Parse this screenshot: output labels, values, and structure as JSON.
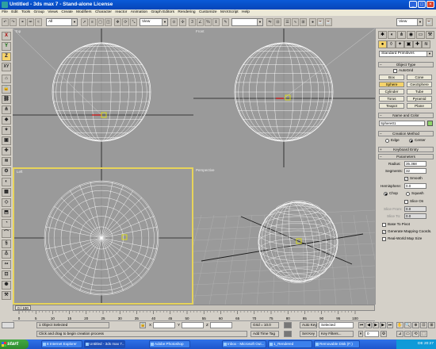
{
  "window": {
    "title": "Untitled - 3ds max 7 - Stand-alone License",
    "controls": {
      "minimize": "_",
      "maximize": "□",
      "close": "×"
    }
  },
  "menu": [
    "File",
    "Edit",
    "Tools",
    "Group",
    "Views",
    "Create",
    "Modifiers",
    "Character",
    "reactor",
    "Animation",
    "Graph Editors",
    "Rendering",
    "Customize",
    "MAXScript",
    "Help"
  ],
  "toolbar": {
    "selection_filter": "All",
    "ref_coord": "View",
    "named_selection": "",
    "render_view": "View"
  },
  "left_toolbar": {
    "x_label": "X",
    "y_label": "Y",
    "z_label": "Z",
    "xy_label": "XY"
  },
  "viewports": {
    "top": "Top",
    "front": "Front",
    "left": "Left",
    "perspective": "Perspective"
  },
  "command_panel": {
    "category": "Standard Primitives",
    "object_type": {
      "title": "Object Type",
      "autogrid": "AutoGrid",
      "buttons": [
        "Box",
        "Cone",
        "Sphere",
        "GeoSphere",
        "Cylinder",
        "Tube",
        "Torus",
        "Pyramid",
        "Teapot",
        "Plane"
      ],
      "selected": "Sphere"
    },
    "name_color": {
      "title": "Name and Color",
      "name": "Sphere01"
    },
    "creation": {
      "title": "Creation Method",
      "edge": "Edge",
      "center": "Center"
    },
    "keyboard": {
      "title": "Keyboard Entry"
    },
    "parameters": {
      "title": "Parameters",
      "radius_label": "Radius:",
      "radius": "35.368",
      "segments_label": "Segments:",
      "segments": "32",
      "smooth": "Smooth",
      "hemisphere_label": "Hemisphere:",
      "hemisphere": "0.0",
      "chop": "Chop",
      "squash": "Squash",
      "slice_on": "Slice On",
      "slice_from_label": "Slice From:",
      "slice_from": "0.0",
      "slice_to_label": "Slice To:",
      "slice_to": "0.0",
      "base_to_pivot": "Base To Pivot",
      "gen_mapping": "Generate Mapping Coords.",
      "real_world": "Real-World Map Size"
    }
  },
  "timeline": {
    "frame_label": "0 / 100",
    "ticks": [
      "0",
      "5",
      "10",
      "15",
      "20",
      "25",
      "30",
      "35",
      "40",
      "45",
      "50",
      "55",
      "60",
      "65",
      "70",
      "75",
      "80",
      "85",
      "90",
      "95",
      "100"
    ]
  },
  "status": {
    "selected": "1 Object Selected",
    "prompt": "Click and drag to begin creation process",
    "x_label": "X",
    "y_label": "Y",
    "z_label": "Z",
    "grid": "Grid = 10.0",
    "add_time_tag": "Add Time Tag",
    "auto_key": "Auto Key",
    "set_key": "Set Key",
    "key_mode": "Selected",
    "key_filters": "Key Filters...",
    "frame_value": "0"
  },
  "taskbar": {
    "start": "start",
    "tasks": [
      "8 Internet Explorer",
      "Untitled - 3ds max 7...",
      "Adobe Photoshop",
      "Inbox - Microsoft Out...",
      "1_Rendered",
      "Removable Disk (F:)"
    ],
    "tray": "DE  20:27"
  }
}
